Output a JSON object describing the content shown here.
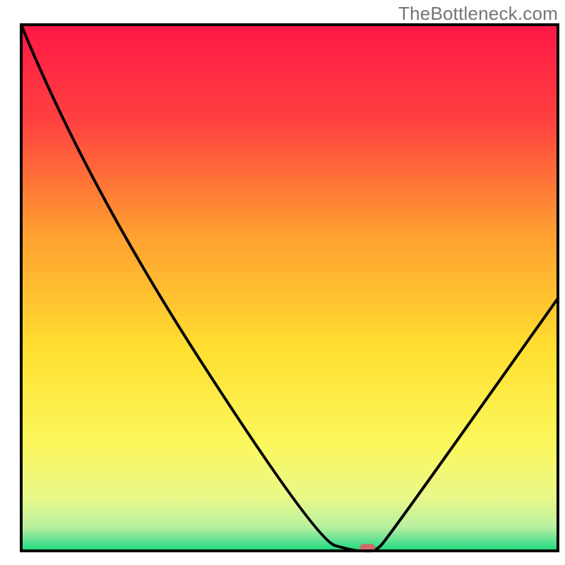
{
  "watermark": "TheBottleneck.com",
  "chart_data": {
    "type": "line",
    "title": "",
    "xlabel": "",
    "ylabel": "",
    "xlim": [
      0,
      100
    ],
    "ylim": [
      0,
      100
    ],
    "grid": false,
    "series": [
      {
        "name": "bottleneck-curve",
        "x": [
          0,
          12,
          55,
          62,
          64,
          66,
          68,
          100
        ],
        "y": [
          100,
          70,
          2,
          0,
          0,
          0,
          2,
          48
        ]
      }
    ],
    "marker": {
      "x": 64.5,
      "y": 0.5,
      "color": "#d06a6a"
    },
    "gradient_stops": [
      {
        "offset": 0.0,
        "color": "#ff1745"
      },
      {
        "offset": 0.18,
        "color": "#ff4040"
      },
      {
        "offset": 0.4,
        "color": "#ffa030"
      },
      {
        "offset": 0.62,
        "color": "#ffe030"
      },
      {
        "offset": 0.8,
        "color": "#fbf85e"
      },
      {
        "offset": 0.9,
        "color": "#e8f88a"
      },
      {
        "offset": 0.955,
        "color": "#b8f0a0"
      },
      {
        "offset": 0.985,
        "color": "#50e090"
      },
      {
        "offset": 1.0,
        "color": "#18d878"
      }
    ],
    "frame": {
      "stroke": "#000000",
      "stroke_width": 4
    }
  }
}
